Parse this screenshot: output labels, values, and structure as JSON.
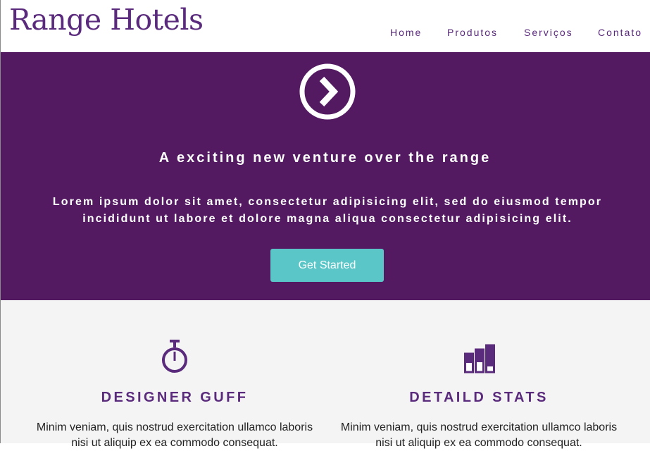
{
  "brand": {
    "name": "Range Hotels"
  },
  "nav": {
    "items": [
      {
        "label": "Home"
      },
      {
        "label": "Produtos"
      },
      {
        "label": "Serviços"
      },
      {
        "label": "Contato"
      }
    ]
  },
  "hero": {
    "icon": "chevron-right-circle-icon",
    "title": "A exciting new venture over the range",
    "text": "Lorem ipsum dolor sit amet, consectetur adipisicing elit, sed do eiusmod tempor incididunt ut labore et dolore magna aliqua consectetur adipisicing elit.",
    "cta_label": "Get Started"
  },
  "features": [
    {
      "icon": "stopwatch-icon",
      "title": "DESIGNER GUFF",
      "text": "Minim veniam, quis nostrud exercitation ullamco laboris nisi ut aliquip ex ea commodo consequat."
    },
    {
      "icon": "bar-stats-icon",
      "title": "DETAILD STATS",
      "text": "Minim veniam, quis nostrud exercitation ullamco laboris nisi ut aliquip ex ea commodo consequat."
    }
  ],
  "colors": {
    "brand_purple": "#531a62",
    "text_purple": "#5a2a7c",
    "accent_teal": "#5bc6c8",
    "features_bg": "#f4f4f4"
  }
}
